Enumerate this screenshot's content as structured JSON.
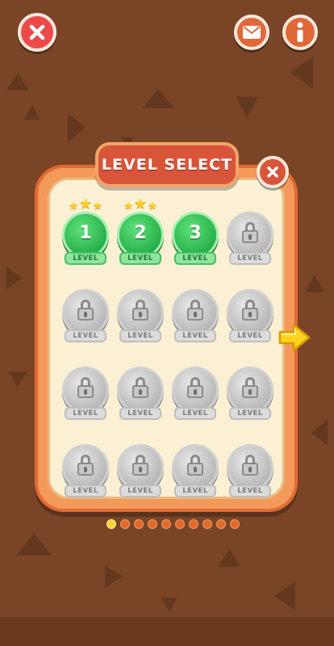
{
  "header": {
    "close_icon": "close-icon",
    "mail_icon": "mail-icon",
    "info_icon": "info-icon"
  },
  "panel": {
    "title": "LEVEL SELECT",
    "close_icon": "close-icon"
  },
  "levels": [
    {
      "number": "1",
      "label": "LEVEL",
      "locked": false,
      "stars": 3
    },
    {
      "number": "2",
      "label": "LEVEL",
      "locked": false,
      "stars": 3
    },
    {
      "number": "3",
      "label": "LEVEL",
      "locked": false,
      "stars": 0
    },
    {
      "number": "",
      "label": "LEVEL",
      "locked": true,
      "stars": 0
    },
    {
      "number": "",
      "label": "LEVEL",
      "locked": true,
      "stars": 0
    },
    {
      "number": "",
      "label": "LEVEL",
      "locked": true,
      "stars": 0
    },
    {
      "number": "",
      "label": "LEVEL",
      "locked": true,
      "stars": 0
    },
    {
      "number": "",
      "label": "LEVEL",
      "locked": true,
      "stars": 0
    },
    {
      "number": "",
      "label": "LEVEL",
      "locked": true,
      "stars": 0
    },
    {
      "number": "",
      "label": "LEVEL",
      "locked": true,
      "stars": 0
    },
    {
      "number": "",
      "label": "LEVEL",
      "locked": true,
      "stars": 0
    },
    {
      "number": "",
      "label": "LEVEL",
      "locked": true,
      "stars": 0
    },
    {
      "number": "",
      "label": "LEVEL",
      "locked": true,
      "stars": 0
    },
    {
      "number": "",
      "label": "LEVEL",
      "locked": true,
      "stars": 0
    },
    {
      "number": "",
      "label": "LEVEL",
      "locked": true,
      "stars": 0
    },
    {
      "number": "",
      "label": "LEVEL",
      "locked": true,
      "stars": 0
    }
  ],
  "pagination": {
    "total_pages": 10,
    "current_page": 1
  },
  "navigation": {
    "next_icon": "arrow-right-icon"
  },
  "colors": {
    "background": "#7a4526",
    "panel_frame": "#f39a5b",
    "panel_inner": "#fcf0d4",
    "title_plate": "#d9553a",
    "unlocked": "#28b14a",
    "locked": "#b9b9b9",
    "star": "#ffd21f",
    "dot_active": "#ffd52e",
    "dot_inactive": "#e06a2c"
  }
}
